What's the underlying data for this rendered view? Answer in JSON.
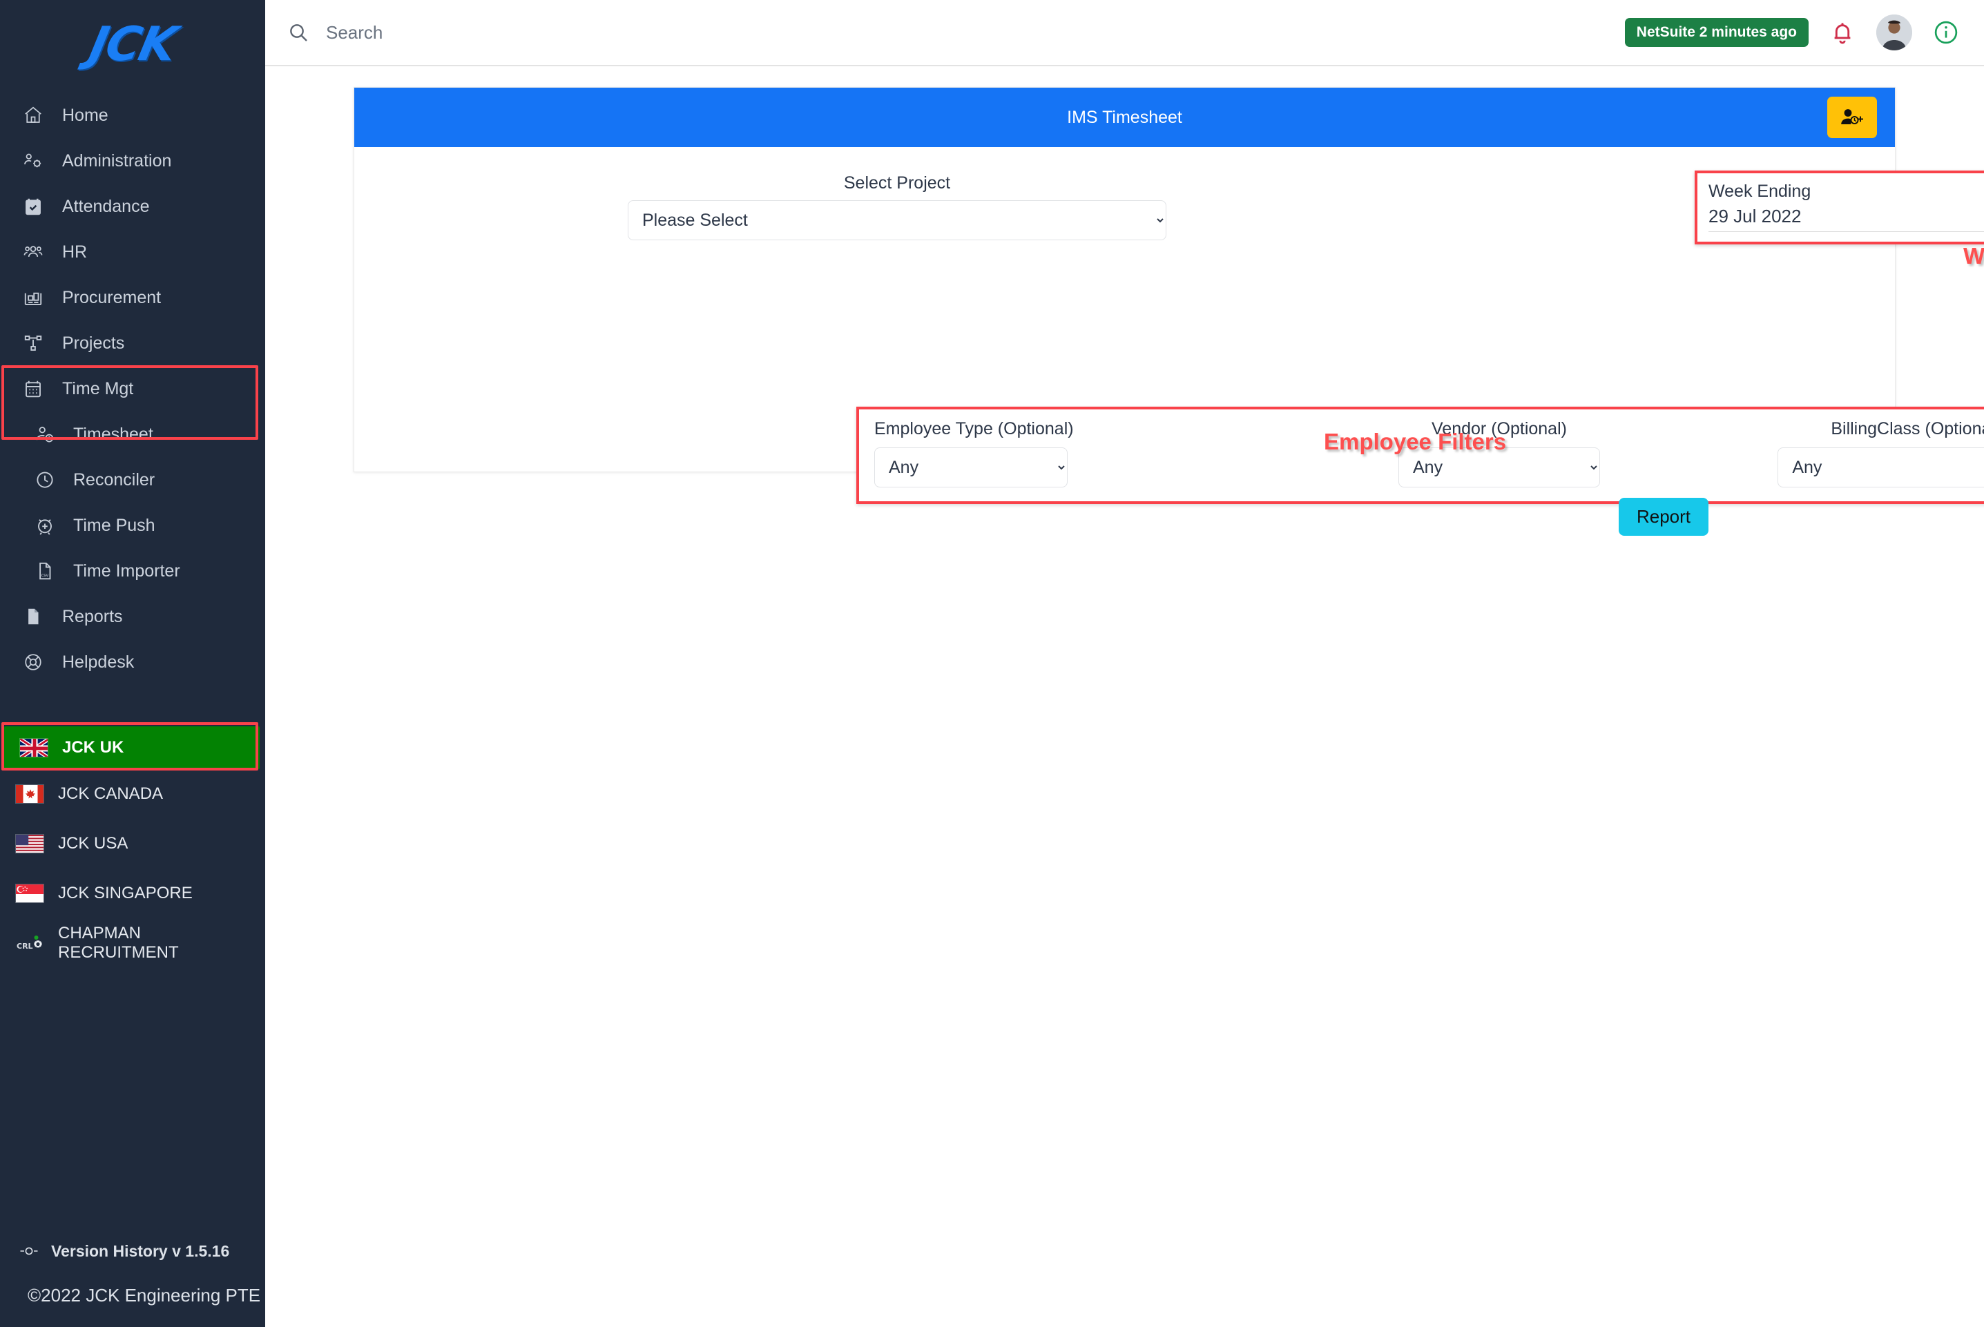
{
  "brand": {
    "logo_text": "JCK"
  },
  "topbar": {
    "search_placeholder": "Search",
    "search_value": "",
    "search_icon": "search-icon",
    "netsuite_badge": "NetSuite 2 minutes ago",
    "bell_icon": "notification-bell-icon",
    "info_icon": "info-circle-icon",
    "avatar": "user-avatar"
  },
  "sidebar": {
    "items": [
      {
        "label": "Home",
        "icon": "home-icon",
        "sub": false
      },
      {
        "label": "Administration",
        "icon": "users-gear-icon",
        "sub": false
      },
      {
        "label": "Attendance",
        "icon": "calendar-check-icon",
        "sub": false
      },
      {
        "label": "HR",
        "icon": "people-group-icon",
        "sub": false
      },
      {
        "label": "Procurement",
        "icon": "warehouse-icon",
        "sub": false
      },
      {
        "label": "Projects",
        "icon": "sitemap-icon",
        "sub": false
      },
      {
        "label": "Time Mgt",
        "icon": "calendar-days-icon",
        "sub": false
      },
      {
        "label": "Timesheet",
        "icon": "user-clock-icon",
        "sub": true
      },
      {
        "label": "Reconciler",
        "icon": "clock-icon",
        "sub": true
      },
      {
        "label": "Time Push",
        "icon": "alarm-plus-icon",
        "sub": true
      },
      {
        "label": "Time Importer",
        "icon": "csv-file-icon",
        "sub": true
      },
      {
        "label": "Reports",
        "icon": "document-icon",
        "sub": false
      },
      {
        "label": "Helpdesk",
        "icon": "lifebuoy-icon",
        "sub": false
      }
    ],
    "countries": [
      {
        "label": "JCK UK",
        "icon": "flag-uk-icon",
        "active": true
      },
      {
        "label": "JCK CANADA",
        "icon": "flag-canada-icon",
        "active": false
      },
      {
        "label": "JCK USA",
        "icon": "flag-usa-icon",
        "active": false
      },
      {
        "label": "JCK SINGAPORE",
        "icon": "flag-singapore-icon",
        "active": false
      },
      {
        "label": "CHAPMAN RECRUITMENT",
        "icon": "crl-logo-icon",
        "active": false
      }
    ],
    "footer": {
      "version": "Version History v 1.5.16",
      "version_icon": "version-node-icon",
      "copyright": "©2022 JCK Engineering PTE"
    },
    "active_color": "#038203",
    "highlight_color": "#f9424a"
  },
  "panel": {
    "title": "IMS Timesheet",
    "header_color": "#1574f5",
    "add_button_icon": "add-user-clock-icon",
    "add_button_color": "#ffc107"
  },
  "form": {
    "project": {
      "label": "Select Project",
      "value": "Please Select",
      "options": [
        "Please Select"
      ]
    },
    "week": {
      "label": "Week Ending",
      "value": "29 Jul 2022"
    },
    "employee_type": {
      "label": "Employee Type (Optional)",
      "value": "Any",
      "options": [
        "Any"
      ]
    },
    "vendor": {
      "label": "Vendor (Optional)",
      "value": "Any",
      "options": [
        "Any"
      ]
    },
    "billing_class": {
      "label": "BillingClass (Optional)",
      "value": "Any",
      "options": [
        "Any"
      ]
    },
    "report_button": "Report",
    "report_button_color": "#17c8ea"
  },
  "annotations": {
    "week_selection": "Week Selection",
    "employee_filters": "Employee Filters",
    "color": "#fd4f4f"
  }
}
